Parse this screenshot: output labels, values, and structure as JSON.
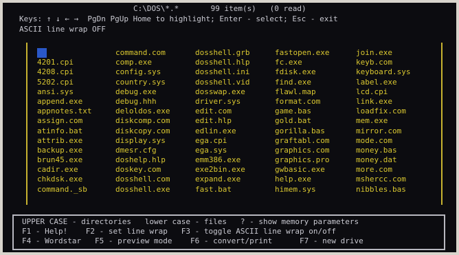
{
  "header": {
    "line1": "C:\\DOS\\*.*       99 item(s)   (0 read)",
    "line2": "Keys: ↑ ↓ ← →  PgDn PgUp Home to highlight; Enter - select; Esc - exit",
    "line3": "ASCII line wrap OFF"
  },
  "files": [
    "..",
    "command.com",
    "dosshell.grb",
    "fastopen.exe",
    "join.exe",
    "4201.cpi",
    "comp.exe",
    "dosshell.hlp",
    "fc.exe",
    "keyb.com",
    "4208.cpi",
    "config.sys",
    "dosshell.ini",
    "fdisk.exe",
    "keyboard.sys",
    "5202.cpi",
    "country.sys",
    "dosshell.vid",
    "find.exe",
    "label.exe",
    "ansi.sys",
    "debug.exe",
    "dosswap.exe",
    "flawl.map",
    "lcd.cpi",
    "append.exe",
    "debug.hhh",
    "driver.sys",
    "format.com",
    "link.exe",
    "appnotes.txt",
    "deloldos.exe",
    "edit.com",
    "game.bas",
    "loadfix.com",
    "assign.com",
    "diskcomp.com",
    "edit.hlp",
    "gold.bat",
    "mem.exe",
    "atinfo.bat",
    "diskcopy.com",
    "edlin.exe",
    "gorilla.bas",
    "mirror.com",
    "attrib.exe",
    "display.sys",
    "ega.cpi",
    "graftabl.com",
    "mode.com",
    "backup.exe",
    "dmesr.cfg",
    "ega.sys",
    "graphics.com",
    "money.bas",
    "brun45.exe",
    "doshelp.hlp",
    "emm386.exe",
    "graphics.pro",
    "money.dat",
    "cadir.exe",
    "doskey.com",
    "exe2bin.exe",
    "gwbasic.exe",
    "more.com",
    "chkdsk.exe",
    "dosshell.com",
    "expand.exe",
    "help.exe",
    "mshercc.com",
    "command._sb",
    "dosshell.exe",
    "fast.bat",
    "himem.sys",
    "nibbles.bas"
  ],
  "footer": {
    "line1": "UPPER CASE - directories   lower case - files   ? - show memory parameters",
    "line2": "F1 - Help!    F2 - set line wrap   F3 - toggle ASCII line wrap on/off",
    "line3": "F4 - Wordstar   F5 - preview mode    F6 - convert/print      F7 - new drive"
  }
}
